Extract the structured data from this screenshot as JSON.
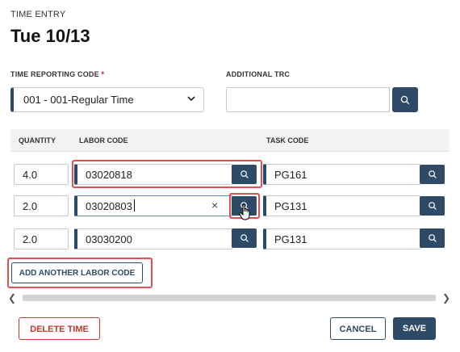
{
  "header": {
    "eyebrow": "TIME ENTRY",
    "title": "Tue 10/13"
  },
  "trc": {
    "label": "TIME REPORTING CODE",
    "required_mark": "*",
    "value": "001 - 001-Regular Time",
    "icon": "chevron-down-icon"
  },
  "additional_trc": {
    "label": "ADDITIONAL TRC",
    "value": "",
    "search_icon": "search-icon"
  },
  "grid": {
    "headers": {
      "quantity": "QUANTITY",
      "labor_code": "LABOR CODE",
      "task_code": "TASK CODE"
    },
    "rows": [
      {
        "quantity": "4.0",
        "labor_code": "03020818",
        "task_code": "PG161"
      },
      {
        "quantity": "2.0",
        "labor_code": "03020803",
        "task_code": "PG131"
      },
      {
        "quantity": "2.0",
        "labor_code": "03030200",
        "task_code": "PG131"
      }
    ],
    "clear_glyph": "×"
  },
  "actions": {
    "add_labor_code": "ADD ANOTHER LABOR CODE",
    "delete": "DELETE TIME",
    "cancel": "CANCEL",
    "save": "SAVE"
  },
  "scrollbar": {
    "left_arrow": "❮",
    "right_arrow": "❯"
  },
  "colors": {
    "primary": "#2e4a66",
    "danger": "#c0392b",
    "highlight": "#e05050",
    "required": "#d0021b"
  }
}
